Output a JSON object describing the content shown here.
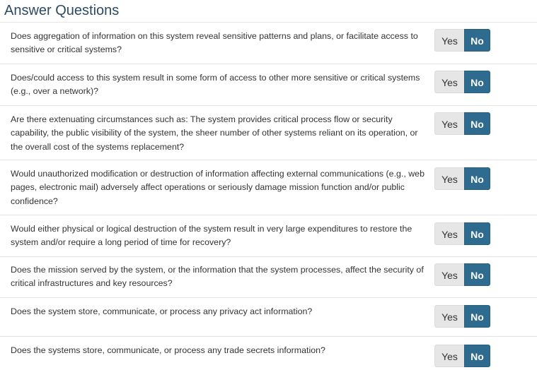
{
  "header": {
    "title": "Answer Questions"
  },
  "questions": [
    {
      "text": "Does aggregation of information on this system reveal sensitive patterns and plans, or facilitate access to sensitive or critical systems?",
      "yes_label": "Yes",
      "no_label": "No",
      "selected": "No"
    },
    {
      "text": "Does/could access to this system result in some form of access to other more sensitive or critical systems (e.g., over a network)?",
      "yes_label": "Yes",
      "no_label": "No",
      "selected": "No"
    },
    {
      "text": "Are there extenuating circumstances such as: The system provides critical process flow or security capability, the public visibility of the system, the sheer number of other systems reliant on its operation, or the overall cost of the systems replacement?",
      "yes_label": "Yes",
      "no_label": "No",
      "selected": "No"
    },
    {
      "text": "Would unauthorized modification or destruction of information affecting external communications (e.g., web pages, electronic mail) adversely affect operations or seriously damage mission function and/or public confidence?",
      "yes_label": "Yes",
      "no_label": "No",
      "selected": "No"
    },
    {
      "text": "Would either physical or logical destruction of the system result in very large expenditures to restore the system and/or require a long period of time for recovery?",
      "yes_label": "Yes",
      "no_label": "No",
      "selected": "No"
    },
    {
      "text": "Does the mission served by the system, or the information that the system processes, affect the security of critical infrastructures and key resources?",
      "yes_label": "Yes",
      "no_label": "No",
      "selected": "No"
    },
    {
      "text": "Does the system store, communicate, or process any privacy act information?",
      "yes_label": "Yes",
      "no_label": "No",
      "selected": "No"
    },
    {
      "text": "Does the systems store, communicate, or process any trade secrets information?",
      "yes_label": "Yes",
      "no_label": "No",
      "selected": "No"
    }
  ],
  "colors": {
    "title": "#2c4a63",
    "selected_button": "#2e6b8e",
    "unselected_button": "#e6e6e6"
  }
}
